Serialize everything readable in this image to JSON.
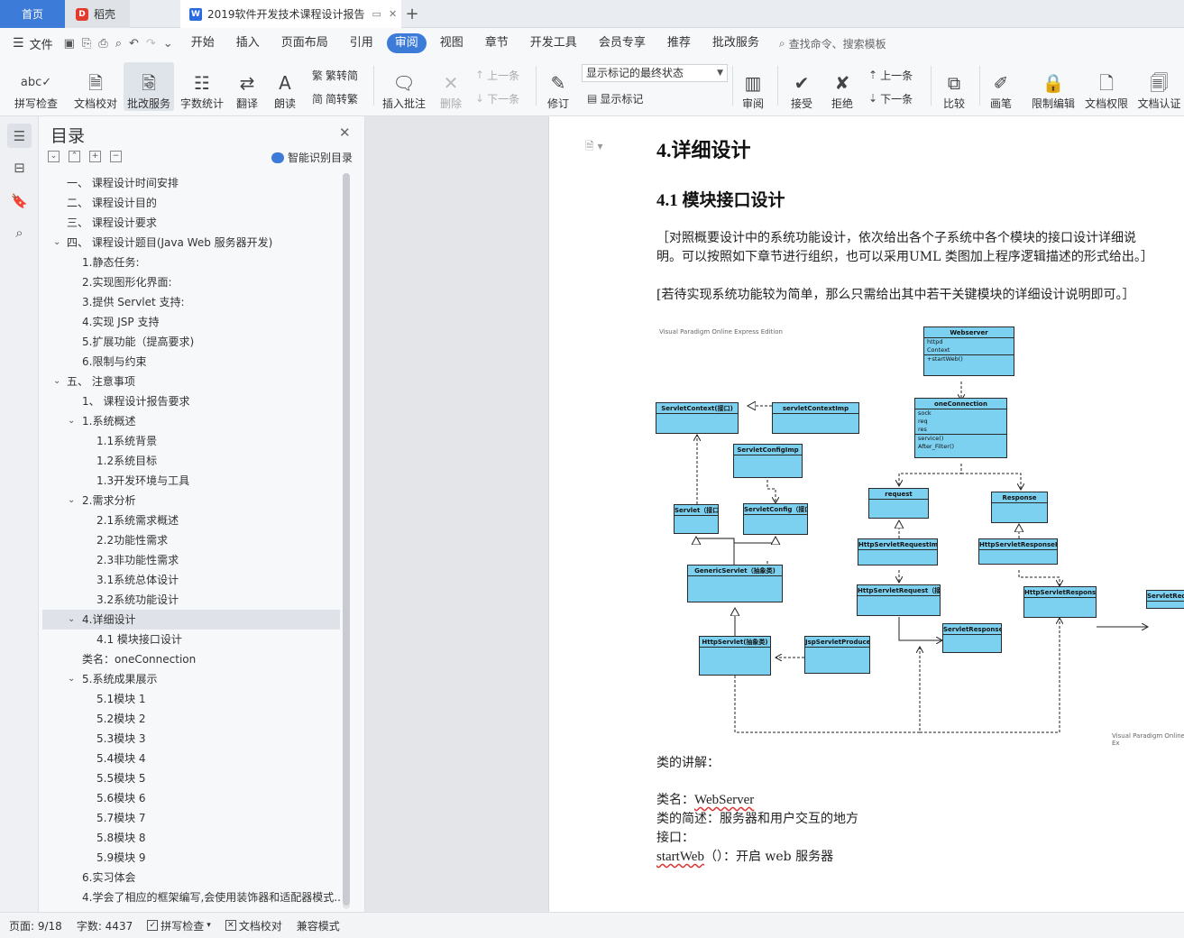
{
  "tabs": {
    "home": "首页",
    "docer": "稻壳",
    "doc_title": "2019软件开发技术课程设计报告",
    "new_tab": "+"
  },
  "menubar": {
    "file": "文件",
    "items": [
      "开始",
      "插入",
      "页面布局",
      "引用",
      "审阅",
      "视图",
      "章节",
      "开发工具",
      "会员专享",
      "推荐",
      "批改服务"
    ],
    "active": "审阅",
    "search": "查找命令、搜索模板"
  },
  "ribbon": {
    "spell_check": "拼写检查",
    "doc_proof": "文档校对",
    "correction_service": "批改服务",
    "word_count": "字数统计",
    "translate": "翻译",
    "read_aloud": "朗读",
    "trad_to_simp": "繁转简",
    "simp_to_trad": "简转繁",
    "insert_comment": "插入批注",
    "delete": "删除",
    "prev": "上一条",
    "next": "下一条",
    "track_changes": "修订",
    "markup_state": "显示标记的最终状态",
    "show_markup": "显示标记",
    "review": "审阅",
    "accept": "接受",
    "reject": "拒绝",
    "prev2": "上一条",
    "next2": "下一条",
    "compare": "比较",
    "pen": "画笔",
    "restrict_edit": "限制编辑",
    "doc_permission": "文档权限",
    "doc_auth": "文档认证"
  },
  "nav": {
    "title": "目录",
    "smart": "智能识别目录",
    "items": [
      {
        "text": "一、 课程设计时间安排",
        "level": 0,
        "arrow": ""
      },
      {
        "text": "二、 课程设计目的",
        "level": 0,
        "arrow": ""
      },
      {
        "text": "三、 课程设计要求",
        "level": 0,
        "arrow": ""
      },
      {
        "text": "四、 课程设计题目(Java Web 服务器开发)",
        "level": 0,
        "arrow": "v"
      },
      {
        "text": "1.静态任务:",
        "level": 1,
        "arrow": ""
      },
      {
        "text": "2.实现图形化界面:",
        "level": 1,
        "arrow": ""
      },
      {
        "text": "3.提供 Servlet 支持:",
        "level": 1,
        "arrow": ""
      },
      {
        "text": "4.实现 JSP 支持",
        "level": 1,
        "arrow": ""
      },
      {
        "text": "5.扩展功能（提高要求)",
        "level": 1,
        "arrow": ""
      },
      {
        "text": "6.限制与约束",
        "level": 1,
        "arrow": ""
      },
      {
        "text": "五、 注意事项",
        "level": 0,
        "arrow": "v"
      },
      {
        "text": "1、 课程设计报告要求",
        "level": 1,
        "arrow": ""
      },
      {
        "text": "1.系统概述",
        "level": 1,
        "arrow": "v"
      },
      {
        "text": "1.1系统背景",
        "level": 2,
        "arrow": ""
      },
      {
        "text": "1.2系统目标",
        "level": 2,
        "arrow": ""
      },
      {
        "text": "1.3开发环境与工具",
        "level": 2,
        "arrow": ""
      },
      {
        "text": "2.需求分析",
        "level": 1,
        "arrow": "v"
      },
      {
        "text": "2.1系统需求概述",
        "level": 2,
        "arrow": ""
      },
      {
        "text": "2.2功能性需求",
        "level": 2,
        "arrow": ""
      },
      {
        "text": "2.3非功能性需求",
        "level": 2,
        "arrow": ""
      },
      {
        "text": "3.1系统总体设计",
        "level": 2,
        "arrow": ""
      },
      {
        "text": "3.2系统功能设计",
        "level": 2,
        "arrow": ""
      },
      {
        "text": "4.详细设计",
        "level": 1,
        "arrow": "v",
        "selected": true
      },
      {
        "text": "4.1 模块接口设计",
        "level": 2,
        "arrow": ""
      },
      {
        "text": "类名：oneConnection",
        "level": 1,
        "arrow": ""
      },
      {
        "text": "5.系统成果展示",
        "level": 1,
        "arrow": "v"
      },
      {
        "text": "5.1模块 1",
        "level": 2,
        "arrow": ""
      },
      {
        "text": "5.2模块 2",
        "level": 2,
        "arrow": ""
      },
      {
        "text": "5.3模块 3",
        "level": 2,
        "arrow": ""
      },
      {
        "text": "5.4模块 4",
        "level": 2,
        "arrow": ""
      },
      {
        "text": "5.5模块 5",
        "level": 2,
        "arrow": ""
      },
      {
        "text": "5.6模块 6",
        "level": 2,
        "arrow": ""
      },
      {
        "text": "5.7模块 7",
        "level": 2,
        "arrow": ""
      },
      {
        "text": "5.8模块 8",
        "level": 2,
        "arrow": ""
      },
      {
        "text": "5.9模块 9",
        "level": 2,
        "arrow": ""
      },
      {
        "text": "6.实习体会",
        "level": 1,
        "arrow": ""
      },
      {
        "text": "4.学会了相应的框架编写,会使用装饰器和适配器模式...",
        "level": 1,
        "arrow": ""
      }
    ]
  },
  "doc": {
    "h1": "4.详细设计",
    "h2": "4.1 模块接口设计",
    "para1": "［对照概要设计中的系统功能设计，依次给出各个子系统中各个模块的接口设计详细说明。可以按照如下章节进行组织，也可以采用UML 类图加上程序逻辑描述的形式给出。］",
    "para2": "[若待实现系统功能较为简单，那么只需给出其中若干关键模块的详细设计说明即可。］",
    "class_explain": "类的讲解：",
    "class_name_label": "类名：",
    "class_name": "WebServer",
    "class_desc": "类的简述：服务器和用户交互的地方",
    "interface": "接口：",
    "method_name": "startWeb",
    "method_desc": "（）：开启 web 服务器"
  },
  "uml": {
    "watermark_top": "Visual Paradigm Online Express Edition",
    "watermark_bottom": "Visual Paradigm Online Ex",
    "classes": {
      "webserver": {
        "name": "Webserver",
        "attrs": [
          "httpd",
          "Context"
        ],
        "ops": [
          "+startWeb()"
        ]
      },
      "oneconnection": {
        "name": "oneConnection",
        "attrs": [
          "sock",
          "req",
          "res"
        ],
        "ops": [
          "service()",
          "After_Filter()"
        ]
      },
      "servletcontext": {
        "name": "ServletContext(接口)"
      },
      "servletcontextimp": {
        "name": "servletContextImp"
      },
      "servletconfigimp": {
        "name": "ServletConfigImp"
      },
      "servlet": {
        "name": "Servlet（接口)"
      },
      "servletconfig": {
        "name": "ServletConfig（接口)"
      },
      "genericservlet": {
        "name": "GenericServlet（抽象类)"
      },
      "request": {
        "name": "request"
      },
      "response": {
        "name": "Response"
      },
      "httpservletrequestimp": {
        "name": "HttpServletRequestImp"
      },
      "httpservletresponseimp": {
        "name": "HttpServletResponseImp"
      },
      "httpservletrequest": {
        "name": "HttpServletRequest（接口)"
      },
      "httpservletresponse": {
        "name": "HttpServletResponse（接口)"
      },
      "servletrequest": {
        "name": "ServletReq"
      },
      "servletresponse": {
        "name": "ServletResponse（接口)"
      },
      "httpservlet": {
        "name": "HttpServlet(抽象类)"
      },
      "jspservletproduce": {
        "name": "JspServletProduce"
      }
    }
  },
  "status": {
    "page": "页面: 9/18",
    "words": "字数: 4437",
    "spell": "拼写检查",
    "proof": "文档校对",
    "compat": "兼容模式"
  }
}
